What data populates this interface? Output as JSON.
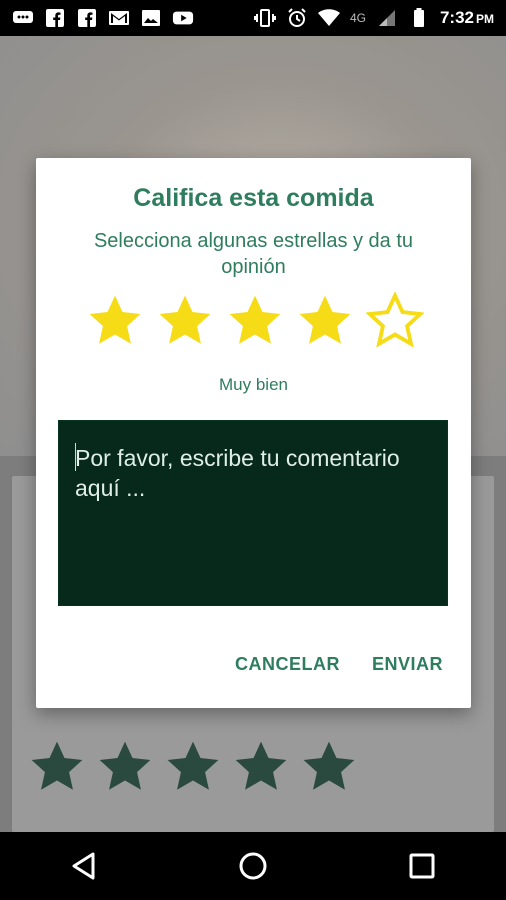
{
  "status_bar": {
    "time": "7:32",
    "time_suffix": "PM",
    "network": "4G",
    "left_icons": [
      "chat-icon",
      "facebook-icon",
      "facebook-icon",
      "gmail-icon",
      "gallery-icon",
      "youtube-icon"
    ],
    "right_icons": [
      "vibrate-icon",
      "alarm-icon",
      "wifi-icon",
      "signal-icon",
      "battery-icon"
    ]
  },
  "dialog": {
    "title": "Califica esta comida",
    "subtitle": "Selecciona algunas estrellas y da tu opinión",
    "rating": 4,
    "max_rating": 5,
    "rating_label": "Muy bien",
    "comment_placeholder": "Por favor, escribe tu comentario aquí ...",
    "cancel_label": "CANCELAR",
    "submit_label": "ENVIAR"
  },
  "background": {
    "stars_count": 5
  },
  "colors": {
    "accent": "#2e7d5e",
    "star_filled": "#f5dc16",
    "comment_bg": "#06291c",
    "bg_star": "#2b4a3f"
  }
}
